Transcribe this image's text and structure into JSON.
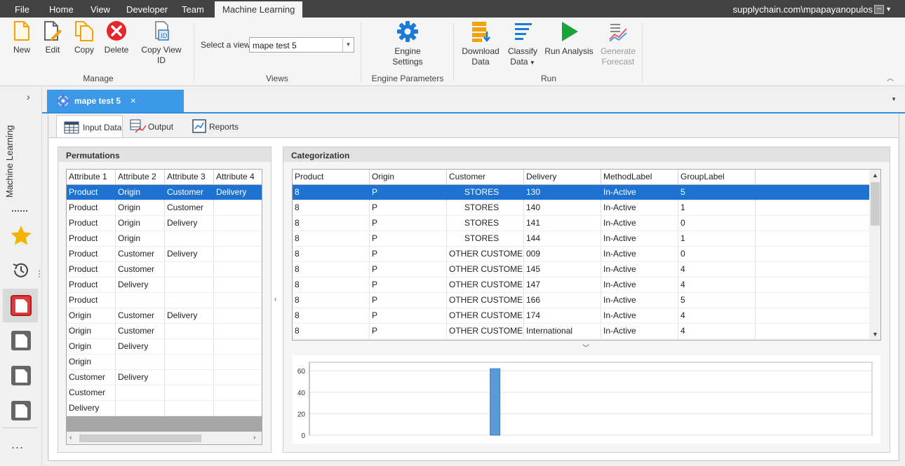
{
  "menu": {
    "file": "File",
    "tabs": [
      "Home",
      "View",
      "Developer",
      "Team",
      "Machine Learning"
    ],
    "active_tab": "Machine Learning",
    "user": "supplychain.com\\mpapayanopulos",
    "user_button": "--"
  },
  "ribbon": {
    "manage": {
      "label": "Manage",
      "new": "New",
      "edit": "Edit",
      "copy": "Copy",
      "delete": "Delete",
      "copy_view_id": "Copy View ID"
    },
    "views": {
      "label": "Views",
      "select_label": "Select a view",
      "selected": "mape test 5"
    },
    "engine": {
      "label": "Engine Parameters",
      "settings_line1": "Engine",
      "settings_line2": "Settings"
    },
    "run": {
      "label": "Run",
      "download_line1": "Download",
      "download_line2": "Data",
      "classify_line1": "Classify",
      "classify_line2": "Data",
      "run_analysis": "Run Analysis",
      "forecast_line1": "Generate",
      "forecast_line2": "Forecast"
    }
  },
  "sidebar": {
    "title": "Machine Learning",
    "more": "..."
  },
  "document_tab": {
    "title": "mape test 5",
    "close": "×"
  },
  "subtabs": [
    "Input Data",
    "Output",
    "Reports"
  ],
  "permutations": {
    "title": "Permutations",
    "columns": [
      "Attribute 1",
      "Attribute 2",
      "Attribute 3",
      "Attribute 4"
    ],
    "rows": [
      [
        "Product",
        "Origin",
        "Customer",
        "Delivery"
      ],
      [
        "Product",
        "Origin",
        "Customer",
        ""
      ],
      [
        "Product",
        "Origin",
        "Delivery",
        ""
      ],
      [
        "Product",
        "Origin",
        "",
        ""
      ],
      [
        "Product",
        "Customer",
        "Delivery",
        ""
      ],
      [
        "Product",
        "Customer",
        "",
        ""
      ],
      [
        "Product",
        "Delivery",
        "",
        ""
      ],
      [
        "Product",
        "",
        "",
        ""
      ],
      [
        "Origin",
        "Customer",
        "Delivery",
        ""
      ],
      [
        "Origin",
        "Customer",
        "",
        ""
      ],
      [
        "Origin",
        "Delivery",
        "",
        ""
      ],
      [
        "Origin",
        "",
        "",
        ""
      ],
      [
        "Customer",
        "Delivery",
        "",
        ""
      ],
      [
        "Customer",
        "",
        "",
        ""
      ],
      [
        "Delivery",
        "",
        "",
        ""
      ]
    ],
    "selected_row": 0
  },
  "categorization": {
    "title": "Categorization",
    "columns": [
      "Product",
      "Origin",
      "Customer",
      "Delivery",
      "MethodLabel",
      "GroupLabel"
    ],
    "rows": [
      [
        "8",
        "P",
        "STORES",
        "130",
        "In-Active",
        "5"
      ],
      [
        "8",
        "P",
        "STORES",
        "140",
        "In-Active",
        "1"
      ],
      [
        "8",
        "P",
        "STORES",
        "141",
        "In-Active",
        "0"
      ],
      [
        "8",
        "P",
        "STORES",
        "144",
        "In-Active",
        "1"
      ],
      [
        "8",
        "P",
        "OTHER CUSTOMER",
        "009",
        "In-Active",
        "0"
      ],
      [
        "8",
        "P",
        "OTHER CUSTOMER",
        "145",
        "In-Active",
        "4"
      ],
      [
        "8",
        "P",
        "OTHER CUSTOMER",
        "147",
        "In-Active",
        "4"
      ],
      [
        "8",
        "P",
        "OTHER CUSTOMER",
        "166",
        "In-Active",
        "5"
      ],
      [
        "8",
        "P",
        "OTHER CUSTOMER",
        "174",
        "In-Active",
        "4"
      ],
      [
        "8",
        "P",
        "OTHER CUSTOMER",
        "International",
        "In-Active",
        "4"
      ]
    ],
    "selected_row": 0
  },
  "chart_data": {
    "type": "bar",
    "y_ticks": [
      "0",
      "20",
      "40",
      "60"
    ],
    "ylim": [
      0,
      68
    ],
    "xlim": [
      0,
      1
    ],
    "bars": [
      {
        "x": 0.33,
        "value": 62
      }
    ],
    "grid": true,
    "bar_color": "#5b9bd5"
  }
}
